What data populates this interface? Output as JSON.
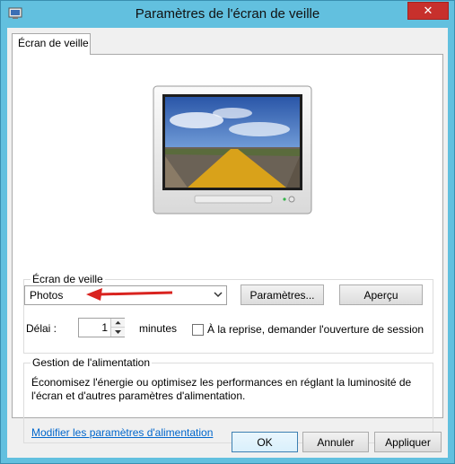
{
  "window": {
    "title": "Paramètres de l'écran de veille",
    "close_glyph": "✕"
  },
  "tab": {
    "label": "Écran de veille"
  },
  "screensaver": {
    "group_label": "Écran de veille",
    "selected": "Photos",
    "settings_button": "Paramètres...",
    "preview_button": "Aperçu",
    "delay_label": "Délai :",
    "delay_value": "1",
    "delay_unit": "minutes",
    "resume_checkbox_label": "À la reprise, demander l'ouverture de session",
    "resume_checked": false
  },
  "power": {
    "group_label": "Gestion de l'alimentation",
    "description_line1": "Économisez l'énergie ou optimisez les performances en réglant la luminosité de",
    "description_line2": "l'écran et d'autres paramètres d'alimentation.",
    "link": "Modifier les paramètres d'alimentation"
  },
  "footer": {
    "ok": "OK",
    "cancel": "Annuler",
    "apply": "Appliquer"
  },
  "colors": {
    "titlebar": "#62c0df",
    "close": "#c7302c",
    "arrow": "#d9231f",
    "link": "#0066cc"
  },
  "icons": [
    "screensaver-app-icon",
    "close-icon",
    "chevron-down-icon",
    "spin-up-icon",
    "spin-down-icon",
    "red-arrow-annotation"
  ]
}
